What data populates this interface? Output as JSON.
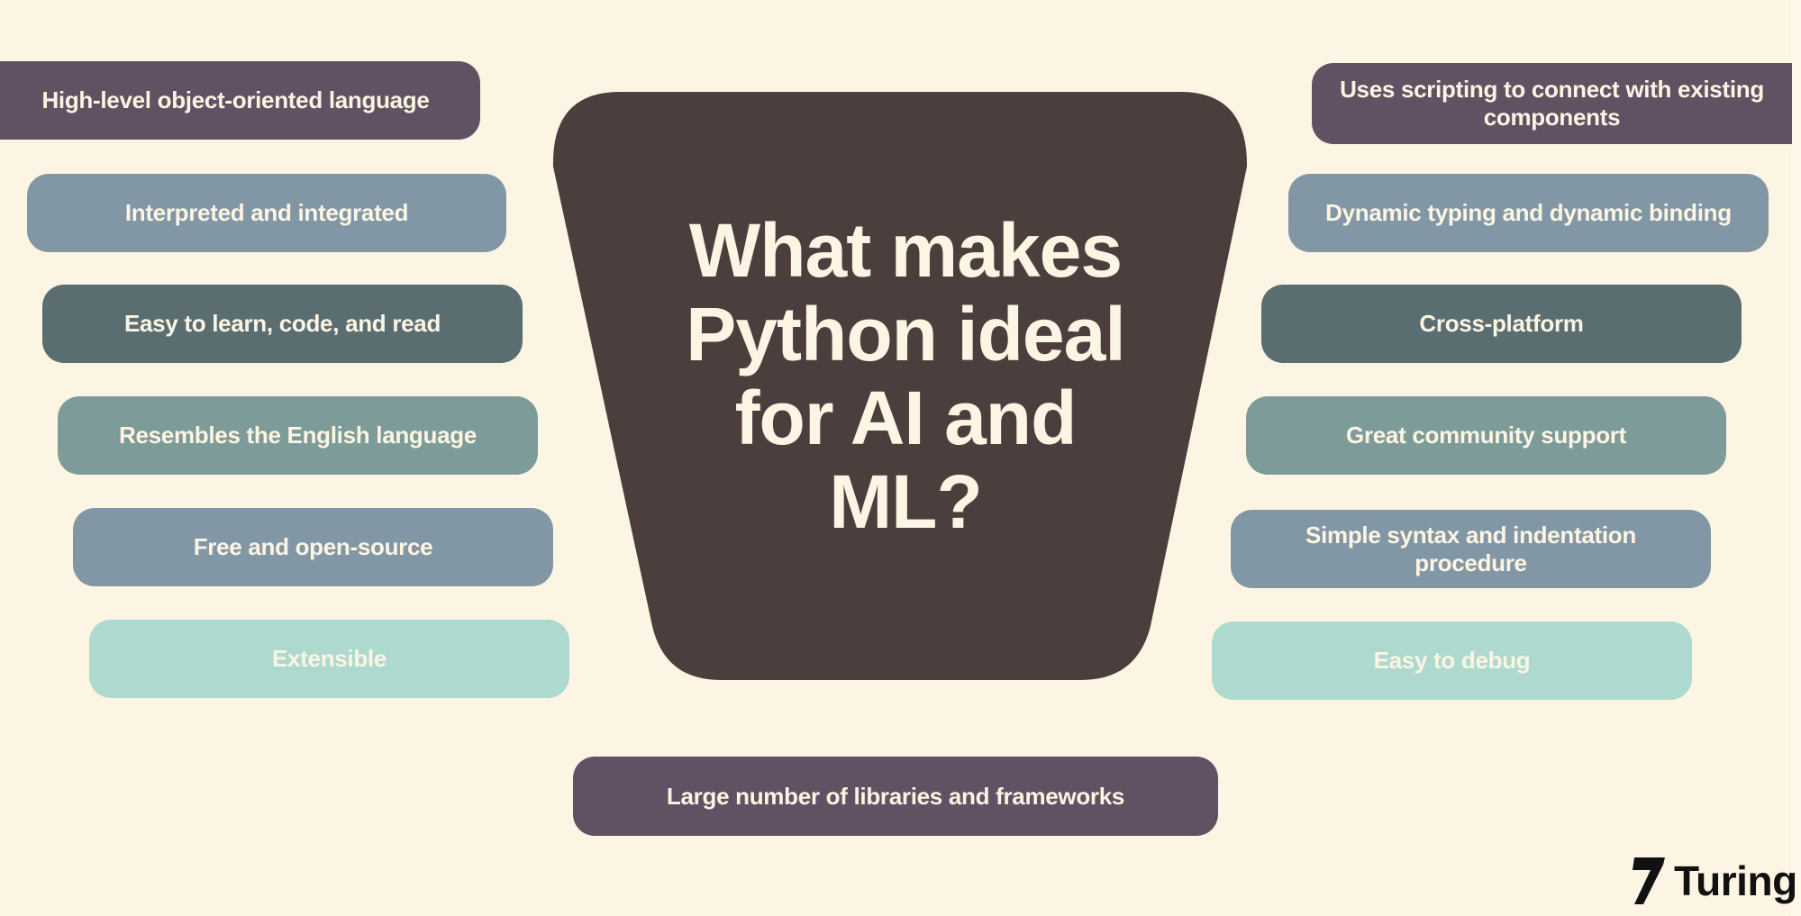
{
  "title": "What makes Python ideal for AI and ML?",
  "title_lines": [
    "What makes",
    "Python ideal",
    "for AI and",
    "ML?"
  ],
  "colors": {
    "background": "#fdf5e3",
    "center_shape": "#4b3e3d",
    "text_light": "#fdf5e3",
    "plum": "#605262",
    "slate_blue": "#8297a5",
    "dark_teal": "#5a6e72",
    "sage": "#7d9b99",
    "mint": "#add9cf"
  },
  "left_features": [
    {
      "label": "High-level object-oriented language",
      "color": "plum"
    },
    {
      "label": "Interpreted and integrated",
      "color": "slate_blue"
    },
    {
      "label": "Easy to learn, code, and read",
      "color": "dark_teal"
    },
    {
      "label": "Resembles the English language",
      "color": "sage"
    },
    {
      "label": "Free and open-source",
      "color": "slate_blue"
    },
    {
      "label": "Extensible",
      "color": "mint"
    }
  ],
  "right_features": [
    {
      "label": "Uses scripting to connect with existing components",
      "color": "plum"
    },
    {
      "label": "Dynamic typing and dynamic binding",
      "color": "slate_blue"
    },
    {
      "label": "Cross-platform",
      "color": "dark_teal"
    },
    {
      "label": "Great community support",
      "color": "sage"
    },
    {
      "label": "Simple syntax and indentation procedure",
      "color": "slate_blue"
    },
    {
      "label": "Easy to debug",
      "color": "mint"
    }
  ],
  "bottom_feature": {
    "label": "Large number of libraries and frameworks",
    "color": "plum"
  },
  "brand": {
    "name": "Turing",
    "icon": "turing-logo-icon"
  }
}
